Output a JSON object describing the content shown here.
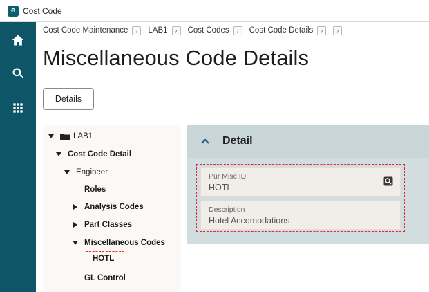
{
  "window": {
    "title": "Cost Code",
    "logo_letter": "e"
  },
  "rail": {
    "items": [
      "home-icon",
      "search-icon",
      "apps-grid-icon"
    ]
  },
  "breadcrumb": [
    "Cost Code Maintenance",
    "LAB1",
    "Cost Codes",
    "Cost Code Details"
  ],
  "page": {
    "title": "Miscellaneous Code Details",
    "details_button": "Details"
  },
  "tree": {
    "root": "LAB1",
    "cost_code_detail": "Cost Code Detail",
    "engineer": "Engineer",
    "roles": "Roles",
    "analysis_codes": "Analysis Codes",
    "part_classes": "Part Classes",
    "misc_codes": "Miscellaneous Codes",
    "hotl": "HOTL",
    "gl_control": "GL Control"
  },
  "detail": {
    "title": "Detail",
    "pur_misc_id_label": "Pur Misc ID",
    "pur_misc_id_value": "HOTL",
    "description_label": "Description",
    "description_value": "Hotel Accomodations"
  },
  "colors": {
    "rail": "#0d5567",
    "accent": "#1d5f75",
    "highlight": "#e0252b"
  }
}
